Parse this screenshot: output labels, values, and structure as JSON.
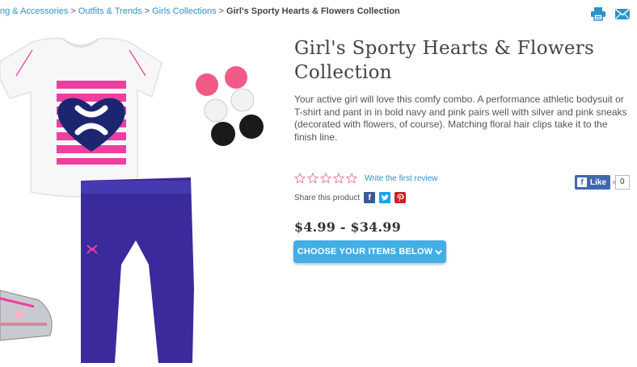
{
  "breadcrumb": {
    "items": [
      "ng & Accessories",
      "Outfits & Trends",
      "Girls Collections"
    ],
    "separator": ">",
    "current": "Girl's Sporty Hearts & Flowers Collection"
  },
  "header_icons": [
    "print-icon",
    "email-icon"
  ],
  "product": {
    "title": "Girl's Sporty Hearts & Flowers Collection",
    "description": "Your active girl will love this comfy combo. A performance athletic bodysuit or T-shirt and pant in in bold navy and pink pairs well with silver and pink sneaks (decorated with flowers, of course). Matching floral hair clips take it to the finish line.",
    "rating": {
      "stars": 0,
      "max": 5,
      "link": "Write the first review"
    },
    "share": {
      "label": "Share this product",
      "networks": [
        "facebook",
        "twitter",
        "pinterest"
      ]
    },
    "facebook_like": {
      "label": "Like",
      "count": "0"
    },
    "price": "$4.99 - $34.99",
    "cta": "CHOOSE YOUR ITEMS BELOW"
  },
  "colors": {
    "link": "#2a93c9",
    "button": "#42aee5",
    "star_outline": "#e87fa8",
    "facebook": "#4267b2",
    "twitter": "#1da1f2",
    "pinterest": "#cb2027",
    "icon": "#2a93c9"
  }
}
